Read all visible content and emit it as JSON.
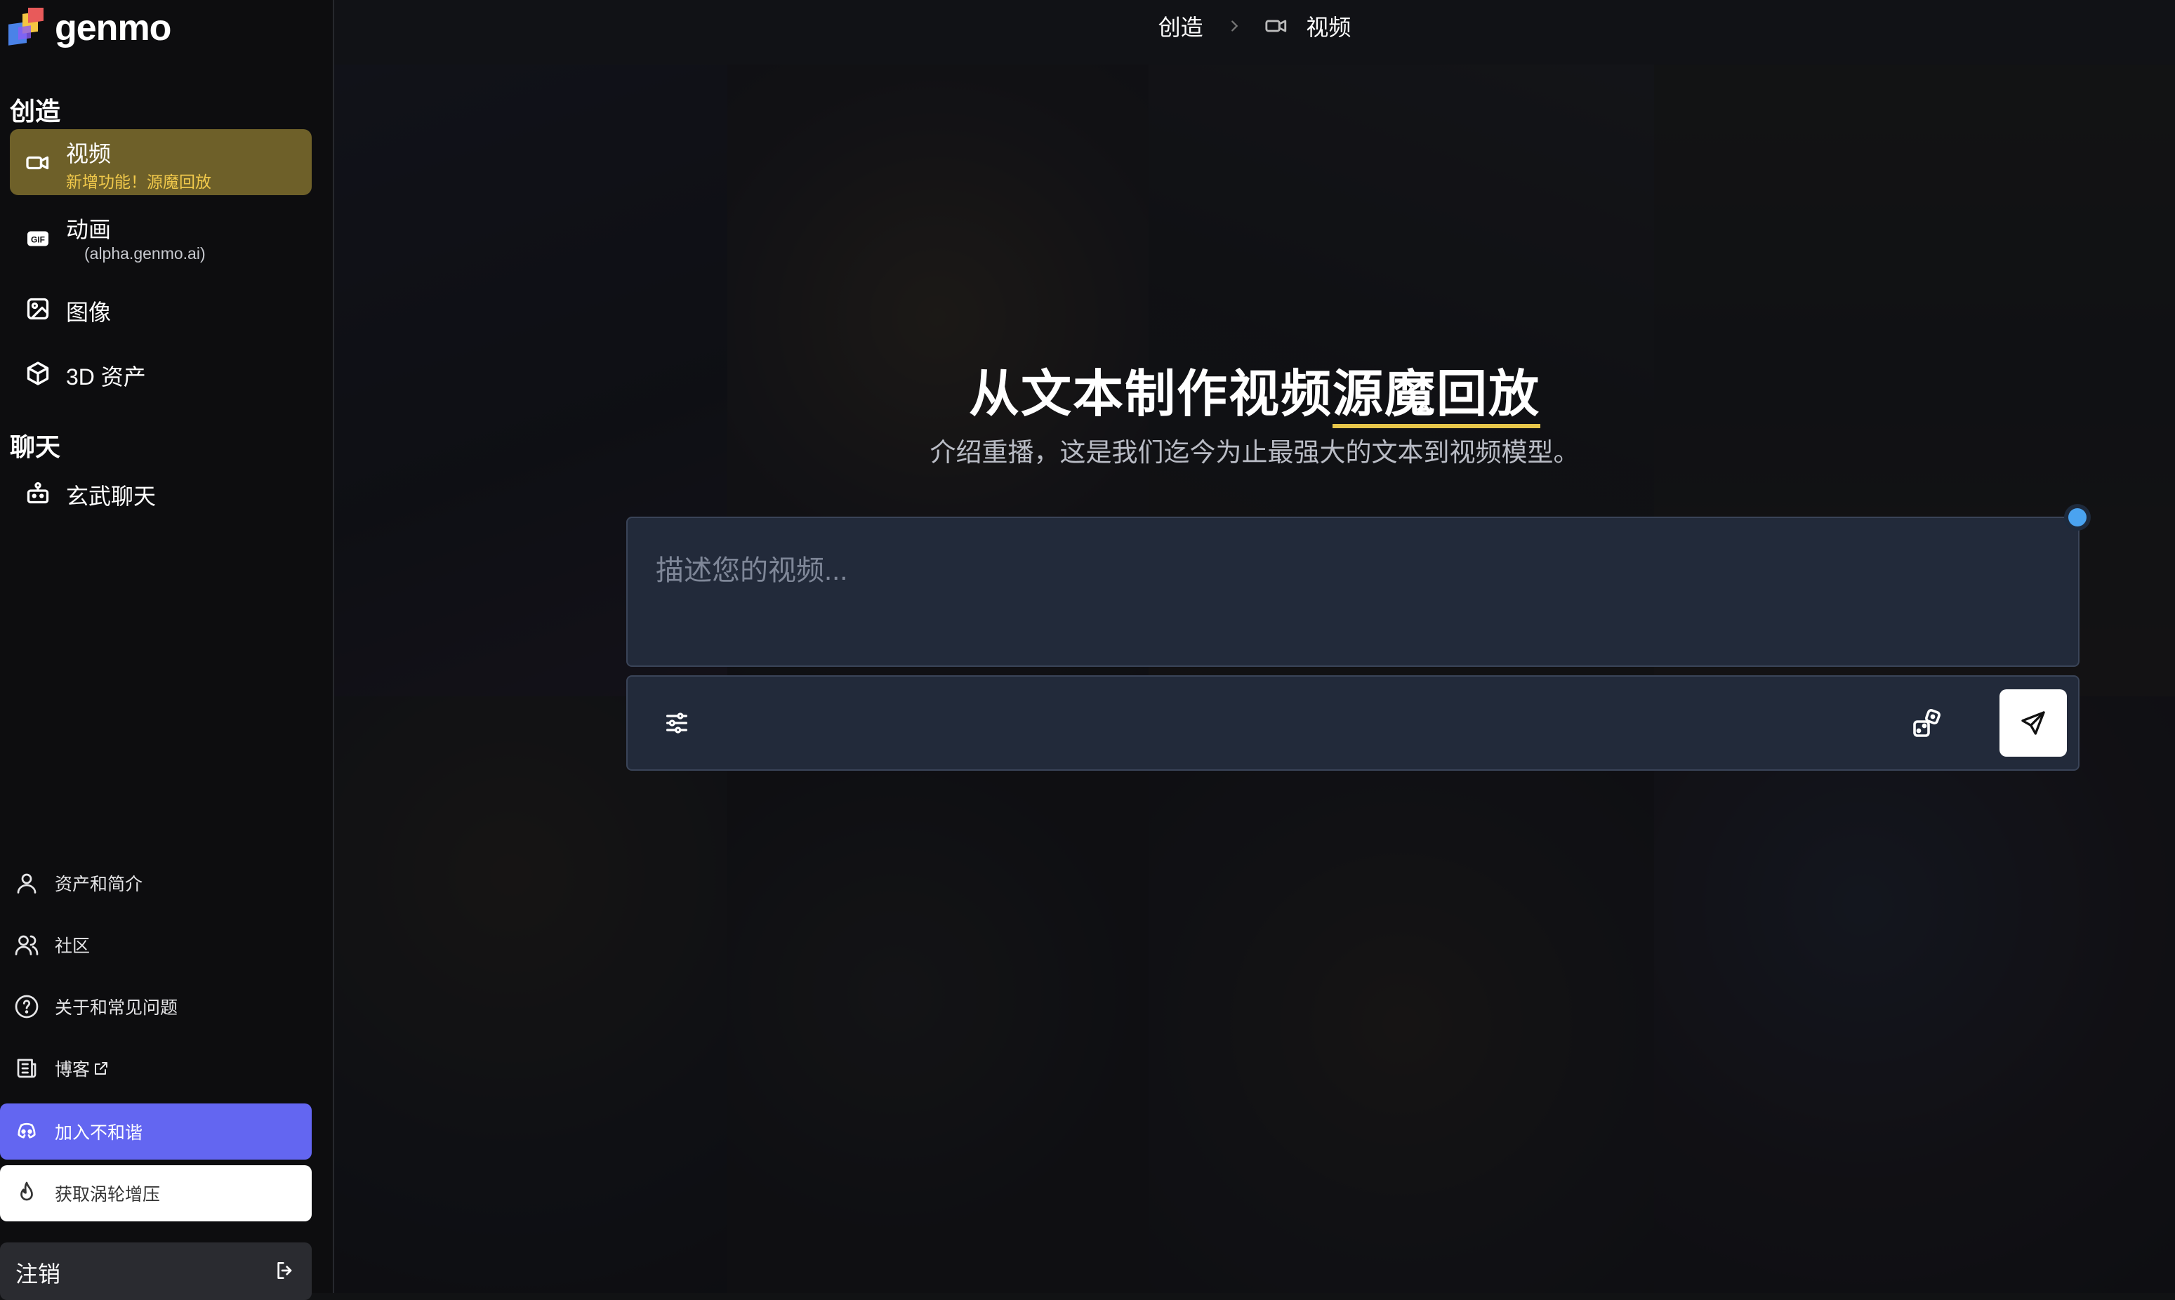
{
  "app": {
    "logo_text": "genmo"
  },
  "breadcrumb": {
    "root": "创造",
    "current": "视频"
  },
  "sidebar": {
    "create_title": "创造",
    "create_items": [
      {
        "label": "视频",
        "sub": "新增功能！源魔回放",
        "icon": "video-icon",
        "active": true
      },
      {
        "label": "动画",
        "sub": "(alpha.genmo.ai)",
        "icon": "gif-icon",
        "active": false
      },
      {
        "label": "图像",
        "icon": "image-icon",
        "active": false
      },
      {
        "label": "3D 资产",
        "icon": "cube-icon",
        "active": false
      }
    ],
    "chat_title": "聊天",
    "chat_items": [
      {
        "label": "玄武聊天",
        "icon": "robot-icon"
      }
    ],
    "bottom_items": [
      {
        "label": "资产和简介",
        "icon": "user-icon"
      },
      {
        "label": "社区",
        "icon": "users-icon"
      },
      {
        "label": "关于和常见问题",
        "icon": "help-circle-icon"
      },
      {
        "label": "博客",
        "icon": "newspaper-icon",
        "external": true
      },
      {
        "label": "加入不和谐",
        "icon": "discord-icon",
        "accent": "#6366f1"
      },
      {
        "label": "获取涡轮增压",
        "icon": "flame-icon"
      }
    ],
    "logout_label": "注销"
  },
  "hero": {
    "title_main": "从文本制作视频",
    "title_highlight": "源魔回放",
    "subtitle": "介绍重播，这是我们迄今为止最强大的文本到视频模型。"
  },
  "prompt": {
    "placeholder": "描述您的视频..."
  },
  "colors": {
    "active_nav": "#6e6029",
    "active_sub": "#f1c94b",
    "discord": "#6366f1",
    "highlight_underline": "#e7c64a",
    "status_dot": "#4aa3f0"
  }
}
